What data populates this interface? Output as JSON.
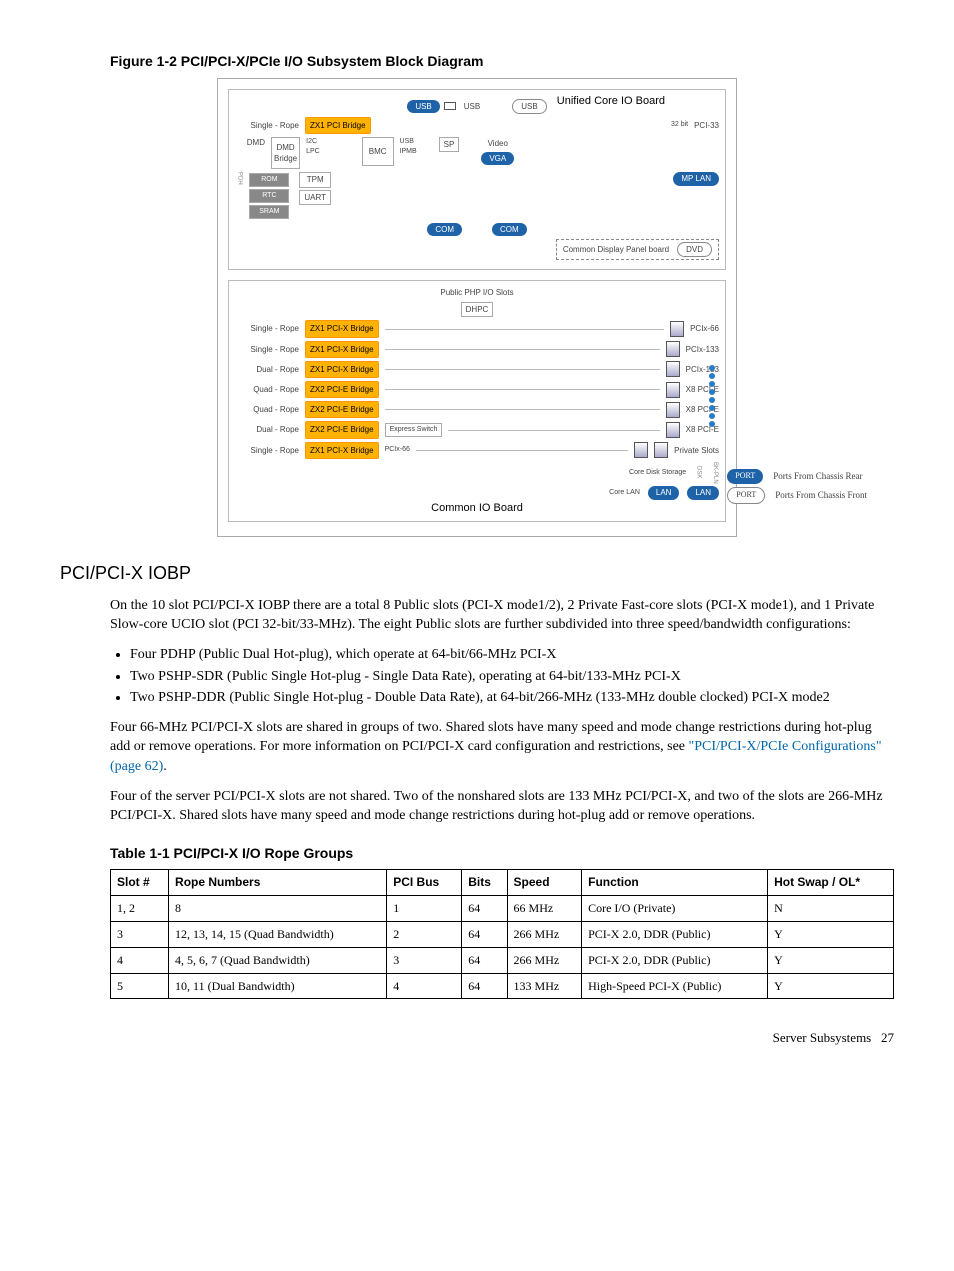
{
  "figure": {
    "caption": "Figure 1-2 PCI/PCI-X/PCIe I/O Subsystem Block Diagram",
    "ucio_title": "Unified Core IO Board",
    "common_io_title": "Common IO Board",
    "top": {
      "single_rope": "Single - Rope",
      "dmd": "DMD",
      "zx1_pci": "ZX1 PCI Bridge",
      "dmd_bridge": "DMD\nBridge",
      "i2c": "I2C",
      "lpc": "LPC",
      "tpm": "TPM",
      "rom": "ROM",
      "rtc": "RTC",
      "sram": "SRAM",
      "uart": "UART",
      "bmc": "BMC",
      "usb_pill": "USB",
      "usb_outline": "USB",
      "usb_slot": "USB",
      "bus32": "32 bit",
      "pci33": "PCI-33",
      "ipmb": "IPMB",
      "sp": "SP",
      "video": "Video",
      "vga": "VGA",
      "mp_lan": "MP LAN",
      "com1": "COM",
      "com2": "COM",
      "display_panel": "Common Display Panel board",
      "dvd": "DVD",
      "pdh": "PDH"
    },
    "public_hdr": "Public PHP I/O Slots",
    "dhpc": "DHPC",
    "ropes": [
      {
        "label": "Single - Rope",
        "bridge": "ZX1 PCI-X Bridge",
        "slot": "PCIx-66"
      },
      {
        "label": "Single - Rope",
        "bridge": "ZX1 PCI-X Bridge",
        "slot": "PCIx-133"
      },
      {
        "label": "Dual - Rope",
        "bridge": "ZX1 PCI-X Bridge",
        "slot": "PCIx-133"
      },
      {
        "label": "Quad - Rope",
        "bridge": "ZX2 PCI-E Bridge",
        "slot": "X8 PCI-E"
      },
      {
        "label": "Quad - Rope",
        "bridge": "ZX2 PCI-E Bridge",
        "slot": "X8 PCI-E"
      },
      {
        "label": "Dual - Rope",
        "bridge": "ZX2 PCI-E Bridge",
        "slot": "X8 PCI-E",
        "extra": "Express Switch"
      },
      {
        "label": "Single - Rope",
        "bridge": "ZX1 PCI-X Bridge",
        "slot": "Private Slots",
        "pci": "PCIx-66"
      }
    ],
    "core_disk": "Core Disk Storage",
    "core_lan": "Core LAN",
    "lan": "LAN",
    "dsk": "DSK",
    "bkpln": "BK-PLN",
    "legend": {
      "rear": "Ports From Chassis Rear",
      "front": "Ports From Chassis Front",
      "port": "PORT"
    }
  },
  "section": {
    "heading": "PCI/PCI-X IOBP",
    "p1": "On the 10 slot PCI/PCI-X IOBP there are a total 8 Public slots (PCI-X mode1/2), 2 Private Fast-core slots (PCI-X mode1), and 1 Private Slow-core UCIO slot (PCI 32-bit/33-MHz). The eight Public slots are further subdivided into three speed/bandwidth configurations:",
    "b1": "Four PDHP (Public Dual Hot-plug), which operate at 64-bit/66-MHz PCI-X",
    "b2": "Two PSHP-SDR (Public Single Hot-plug - Single Data Rate), operating at 64-bit/133-MHz PCI-X",
    "b3": "Two PSHP-DDR (Public Single Hot-plug - Double Data Rate), at 64-bit/266-MHz (133-MHz double clocked) PCI-X mode2",
    "p2a": "Four 66-MHz PCI/PCI-X slots are shared in groups of two. Shared slots have many speed and mode change restrictions during hot-plug add or remove operations. For more information on PCI/PCI-X card configuration and restrictions, see ",
    "p2link": "\"PCI/PCI-X/PCIe Configurations\" (page 62)",
    "p2b": ".",
    "p3": "Four of the server PCI/PCI-X slots are not shared. Two of the nonshared slots are 133 MHz PCI/PCI-X, and two of the slots are 266-MHz PCI/PCI-X. Shared slots have many speed and mode change restrictions during hot-plug add or remove operations."
  },
  "table": {
    "caption": "Table 1-1 PCI/PCI-X I/O Rope Groups",
    "headers": [
      "Slot #",
      "Rope Numbers",
      "PCI Bus",
      "Bits",
      "Speed",
      "Function",
      "Hot Swap / OL*"
    ],
    "rows": [
      [
        "1, 2",
        "8",
        "1",
        "64",
        "66 MHz",
        "Core I/O (Private)",
        "N"
      ],
      [
        "3",
        "12, 13, 14, 15 (Quad Bandwidth)",
        "2",
        "64",
        "266 MHz",
        "PCI-X 2.0, DDR (Public)",
        "Y"
      ],
      [
        "4",
        "4, 5, 6, 7 (Quad Bandwidth)",
        "3",
        "64",
        "266 MHz",
        "PCI-X 2.0, DDR (Public)",
        "Y"
      ],
      [
        "5",
        "10, 11 (Dual Bandwidth)",
        "4",
        "64",
        "133 MHz",
        "High-Speed PCI-X (Public)",
        "Y"
      ]
    ]
  },
  "footer": {
    "left": "Server Subsystems",
    "page": "27"
  }
}
